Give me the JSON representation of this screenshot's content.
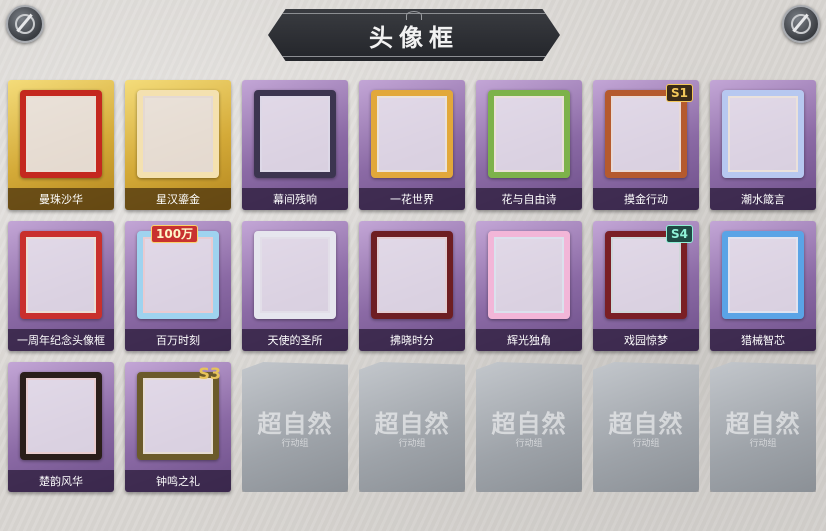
{
  "header": {
    "title": "头像框"
  },
  "frames": [
    {
      "label": "曼珠沙华",
      "theme": "gold",
      "frame_color": "#c4281f",
      "accent": "#f2b640"
    },
    {
      "label": "星汉鎏金",
      "theme": "gold",
      "frame_color": "#f4e1b0",
      "accent": "#c69b47"
    },
    {
      "label": "幕间残响",
      "theme": "purple",
      "frame_color": "#3c3550",
      "accent": "#9a95c8"
    },
    {
      "label": "一花世界",
      "theme": "purple",
      "frame_color": "#e2a83a",
      "accent": "#f6d36a"
    },
    {
      "label": "花与自由诗",
      "theme": "purple",
      "frame_color": "#7db24a",
      "accent": "#f2c85c"
    },
    {
      "label": "摸金行动",
      "theme": "purple",
      "frame_color": "#b55a2e",
      "accent": "#e59a5a",
      "badge": "S1",
      "badge_style": ""
    },
    {
      "label": "潮水箴言",
      "theme": "purple",
      "frame_color": "#b7c8f0",
      "accent": "#f2d27a"
    },
    {
      "label": "一周年纪念头像框",
      "theme": "purple",
      "frame_color": "#c9302c",
      "accent": "#f1be4a"
    },
    {
      "label": "百万时刻",
      "theme": "purple",
      "frame_color": "#9fd3ef",
      "accent": "#e7403a",
      "badge": "100万",
      "badge_style": "banner"
    },
    {
      "label": "天使的圣所",
      "theme": "purple",
      "frame_color": "#e6e6ee",
      "accent": "#b9b9cc"
    },
    {
      "label": "拂晓时分",
      "theme": "purple",
      "frame_color": "#6e1e22",
      "accent": "#c44a3a"
    },
    {
      "label": "辉光独角",
      "theme": "purple",
      "frame_color": "#f2b6d8",
      "accent": "#8fd1f0"
    },
    {
      "label": "戏园惊梦",
      "theme": "purple",
      "frame_color": "#7a1f25",
      "accent": "#3f8a6e",
      "badge": "S4",
      "badge_style": "teal"
    },
    {
      "label": "猎械智芯",
      "theme": "purple",
      "frame_color": "#5aa4e6",
      "accent": "#b3dcff"
    },
    {
      "label": "楚韵风华",
      "theme": "purple",
      "frame_color": "#2a1e1a",
      "accent": "#e0482a"
    },
    {
      "label": "钟鸣之礼",
      "theme": "purple",
      "frame_color": "#6b5a2a",
      "accent": "#d5b04a",
      "badge": "S3",
      "badge_style": "plain"
    }
  ],
  "locked": {
    "count_shown": 5,
    "watermark": "超自然",
    "subtext": "行动组"
  }
}
